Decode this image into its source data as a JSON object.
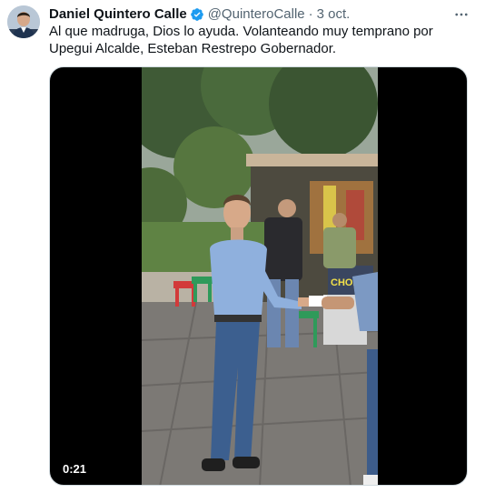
{
  "tweet": {
    "author_name": "Daniel Quintero Calle",
    "handle": "@QuinteroCalle",
    "separator": "·",
    "date": "3 oct.",
    "text": "Al que madruga, Dios lo ayuda. Volanteando muy temprano por Upegui Alcalde, Esteban Restrepo Gobernador.",
    "verified_icon": "verified-badge-icon",
    "verified_color": "#1d9bf0"
  },
  "video": {
    "duration": "0:21",
    "sign_text": "CHORIZOS"
  },
  "colors": {
    "text_primary": "#0f1419",
    "text_secondary": "#536471",
    "border": "#cfd9de"
  }
}
